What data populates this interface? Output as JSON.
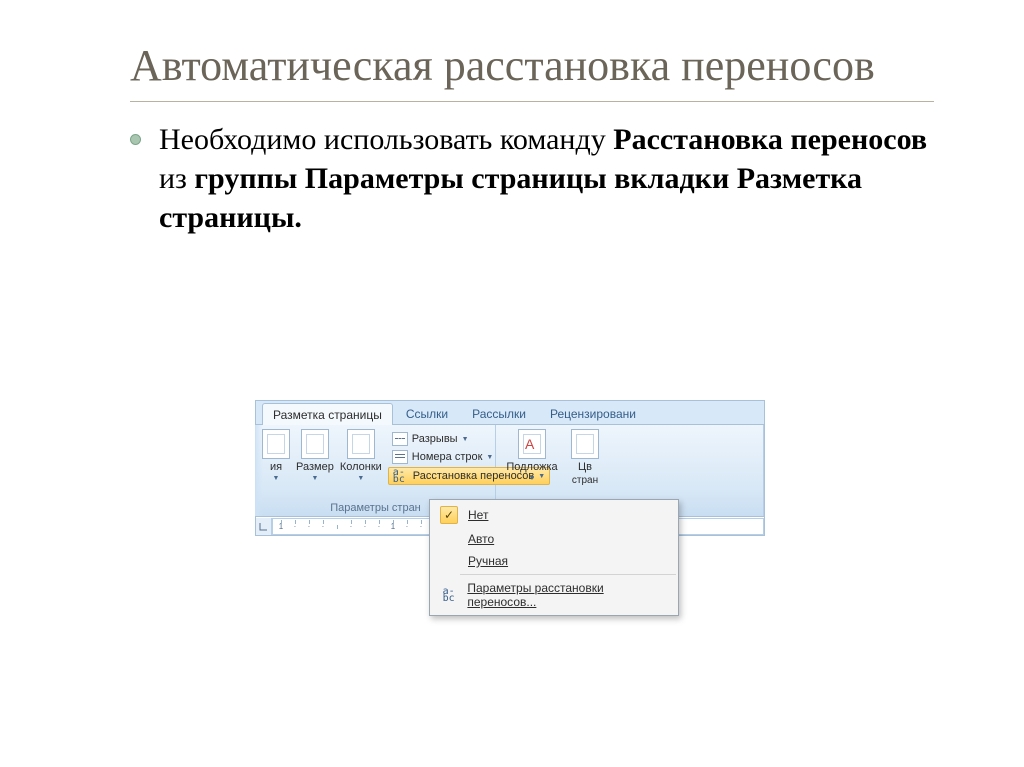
{
  "title": "Автоматическая расстановка переносов",
  "bullet": {
    "part1": "Необходимо использовать команду ",
    "bold1": "Расстановка переносов",
    "part2": " из ",
    "bold2": "группы Параметры страницы вкладки Разметка страницы."
  },
  "ribbon": {
    "tabs": {
      "active": "Разметка страницы",
      "t2": "Ссылки",
      "t3": "Рассылки",
      "t4": "Рецензировани"
    },
    "group_label": "Параметры стран",
    "btn_orientation_trunc": "ия",
    "btn_size": "Размер",
    "btn_columns": "Колонки",
    "btn_breaks": "Разрывы",
    "btn_linenumbers": "Номера строк",
    "btn_hyphenation": "Расстановка переносов",
    "btn_watermark": "Подложка",
    "btn_color_trunc": "Цв",
    "btn_color_sub": "стран"
  },
  "dropdown": {
    "none": "Нет",
    "auto": "Авто",
    "manual": "Ручная",
    "options": "Параметры расстановки переносов..."
  },
  "ruler": {
    "marks": [
      "1",
      "·",
      "·",
      "·",
      "",
      "·",
      "·",
      "·",
      "1",
      "·",
      "·",
      "·"
    ]
  }
}
